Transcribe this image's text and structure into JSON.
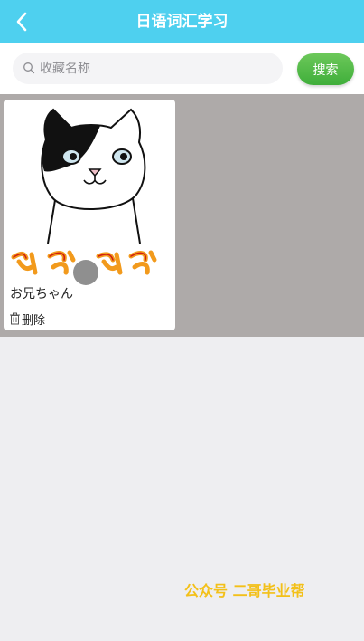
{
  "header": {
    "title": "日语词汇学习",
    "back_icon": "chevron-left-icon"
  },
  "search": {
    "placeholder": "收藏名称",
    "value": "",
    "button_label": "搜索",
    "icon": "search-icon"
  },
  "favorites": [
    {
      "name": "お兄ちゃん",
      "delete_label": "删除",
      "delete_icon": "trash-icon",
      "image": "cartoon cat"
    }
  ],
  "watermark": "公众号 二哥毕业帮",
  "colors": {
    "header_bg": "#4ed0ef",
    "search_button": "#4cb845",
    "results_bg": "#aeaaa9",
    "page_bg": "#eeeef1",
    "watermark": "#f3c019"
  }
}
